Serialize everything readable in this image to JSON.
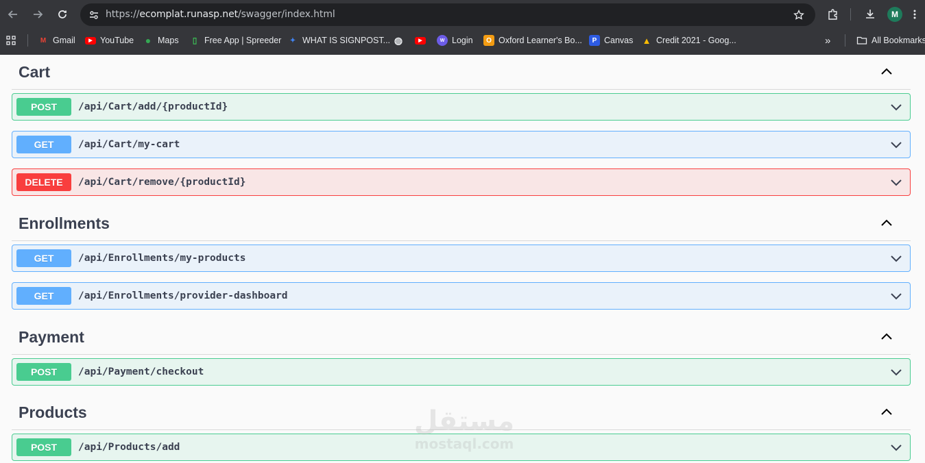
{
  "browser": {
    "url_host": "ecomplat.runasp.net",
    "url_path": "/swagger/index.html",
    "url_scheme": "https://",
    "profile_initial": "M",
    "bookmarks": [
      {
        "label": "Gmail",
        "icon": "gmail-icon",
        "color": "#ea4335"
      },
      {
        "label": "YouTube",
        "icon": "youtube-icon",
        "color": "#ff0000"
      },
      {
        "label": "Maps",
        "icon": "maps-icon",
        "color": "#34a853"
      },
      {
        "label": "Free App | Spreeder",
        "icon": "spreeder-icon",
        "color": "#3cba54"
      },
      {
        "label": "WHAT IS SIGNPOST...",
        "icon": "signpost-icon",
        "color": "#4285f4"
      },
      {
        "label": "",
        "icon": "globe-icon",
        "color": "#e8eaed"
      },
      {
        "label": "",
        "icon": "youtube-icon",
        "color": "#ff0000"
      },
      {
        "label": "Login",
        "icon": "login-icon",
        "color": "#6c5ce7"
      },
      {
        "label": "Oxford Learner's Bo...",
        "icon": "oxford-icon",
        "color": "#f39c12"
      },
      {
        "label": "Canvas",
        "icon": "canvas-icon",
        "color": "#2d5be3"
      },
      {
        "label": "Credit 2021  - Goog...",
        "icon": "google-drive-icon",
        "color": "#fbbc04"
      }
    ],
    "more_label": "»",
    "all_bookmarks_label": "All Bookmarks"
  },
  "sections": [
    {
      "title": "Cart",
      "operations": [
        {
          "method": "POST",
          "path": "/api/Cart/add/{productId}"
        },
        {
          "method": "GET",
          "path": "/api/Cart/my-cart"
        },
        {
          "method": "DELETE",
          "path": "/api/Cart/remove/{productId}"
        }
      ]
    },
    {
      "title": "Enrollments",
      "operations": [
        {
          "method": "GET",
          "path": "/api/Enrollments/my-products"
        },
        {
          "method": "GET",
          "path": "/api/Enrollments/provider-dashboard"
        }
      ]
    },
    {
      "title": "Payment",
      "operations": [
        {
          "method": "POST",
          "path": "/api/Payment/checkout"
        }
      ]
    },
    {
      "title": "Products",
      "operations": [
        {
          "method": "POST",
          "path": "/api/Products/add"
        }
      ]
    }
  ],
  "watermark": {
    "arabic": "مستقل",
    "latin": "mostaql.com"
  },
  "colors": {
    "post": "#49cc90",
    "get": "#61affe",
    "delete": "#f93e3e",
    "title": "#3b4151"
  }
}
